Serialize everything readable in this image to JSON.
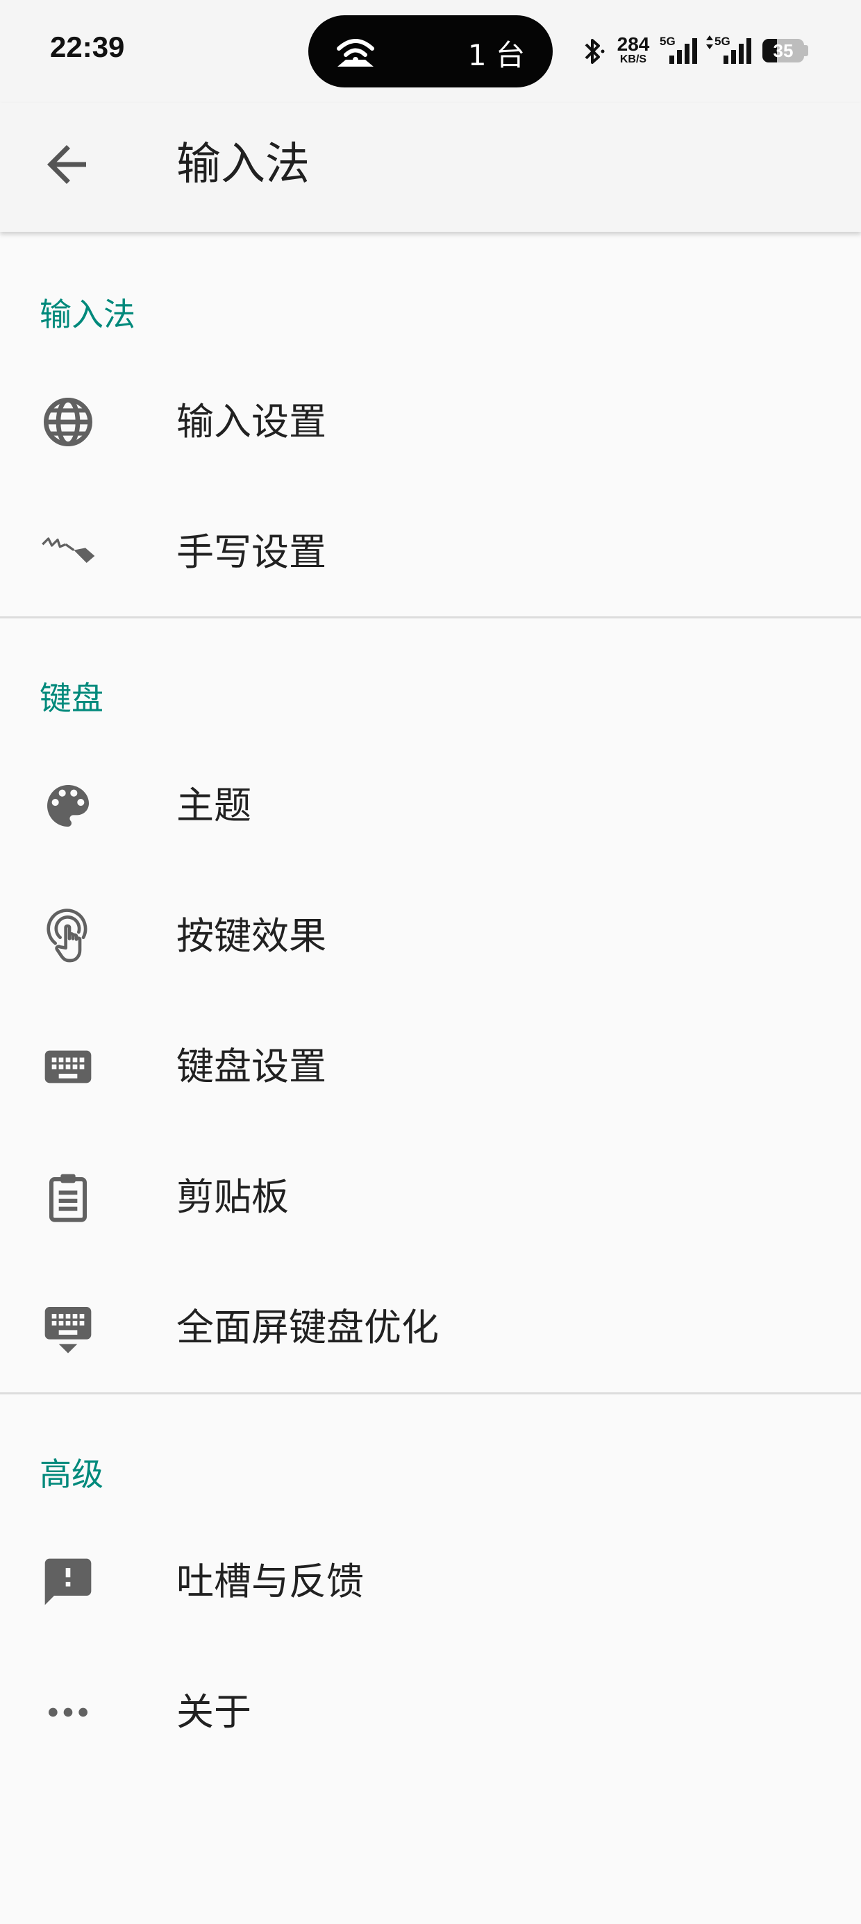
{
  "status_bar": {
    "time": "22:39",
    "hotspot_count": "1 台",
    "net_speed_value": "284",
    "net_speed_unit": "KB/S",
    "sim1_label": "5G",
    "sim2_label": "5G",
    "battery_level": "35"
  },
  "header": {
    "title": "输入法"
  },
  "sections": [
    {
      "title": "输入法",
      "items": [
        {
          "label": "输入设置",
          "icon": "globe-icon"
        },
        {
          "label": "手写设置",
          "icon": "handwriting-icon"
        }
      ]
    },
    {
      "title": "键盘",
      "items": [
        {
          "label": "主题",
          "icon": "palette-icon"
        },
        {
          "label": "按键效果",
          "icon": "touch-icon"
        },
        {
          "label": "键盘设置",
          "icon": "keyboard-icon"
        },
        {
          "label": "剪贴板",
          "icon": "clipboard-icon"
        },
        {
          "label": "全面屏键盘优化",
          "icon": "keyboard-hide-icon"
        }
      ]
    },
    {
      "title": "高级",
      "items": [
        {
          "label": "吐槽与反馈",
          "icon": "feedback-icon"
        },
        {
          "label": "关于",
          "icon": "more-icon"
        }
      ]
    }
  ],
  "colors": {
    "accent": "#00897b",
    "icon": "#616161",
    "background": "#fafafa",
    "appbar": "#f5f5f5"
  }
}
